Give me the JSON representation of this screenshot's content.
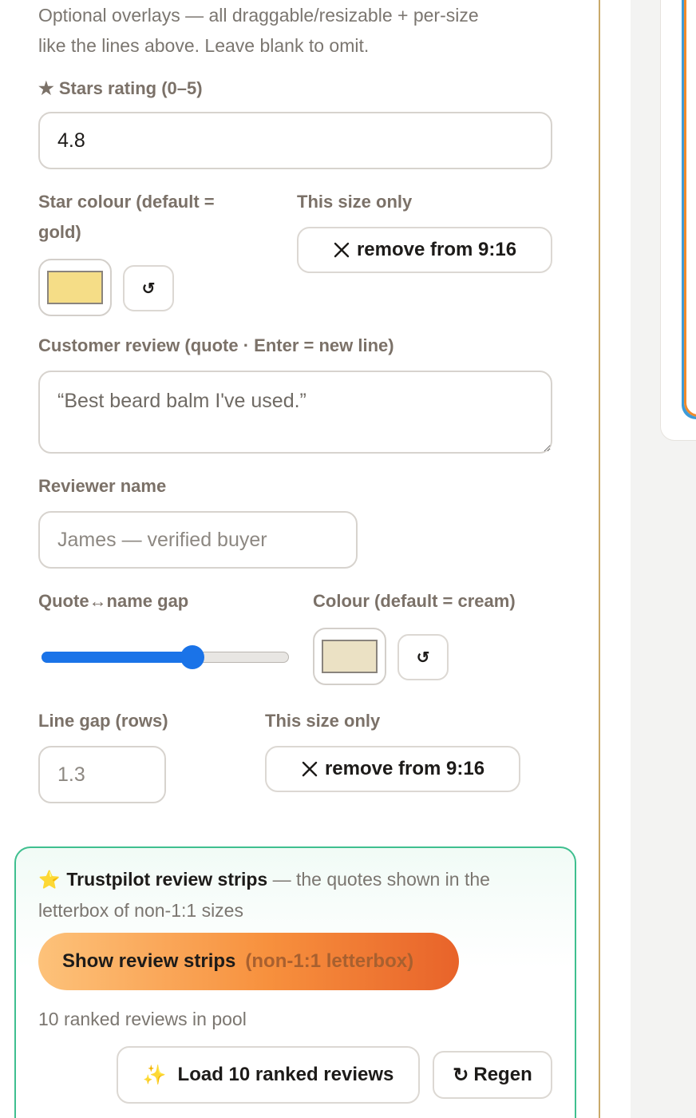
{
  "intro": {
    "help_line1": "Optional overlays — all draggable/resizable + per-size",
    "help_line2": "like the lines above. Leave blank to omit."
  },
  "stars": {
    "label": "★ Stars rating (0–5)",
    "value": "4.8",
    "colour_label_line1": "Star colour (default =",
    "colour_label_line2": "gold)",
    "colour_hex": "#f5dd87",
    "reset_label": "↺",
    "size_only_label": "This size only",
    "remove_label": "remove from 9:16"
  },
  "review": {
    "label": "Customer review (quote · Enter = new line)",
    "placeholder": "“Best beard balm I've used.”"
  },
  "reviewer": {
    "label": "Reviewer name",
    "placeholder": "James — verified buyer"
  },
  "gap": {
    "label": "Quote↔name gap",
    "slider_fraction": 0.61,
    "colour_label": "Colour (default = cream)",
    "colour_hex": "#ebe1c4",
    "reset_label": "↺"
  },
  "line_gap": {
    "label": "Line gap (rows)",
    "value": "1.3",
    "size_only_label": "This size only",
    "remove_label": "remove from 9:16"
  },
  "trustpilot": {
    "star_icon": "⭐",
    "title": "Trustpilot review strips",
    "desc_a": " — the quotes shown in the",
    "desc_b": "letterbox of non-1:1 sizes",
    "toggle_label": "Show review strips",
    "toggle_sub": "(non-1:1 letterbox)",
    "pool_text": "10 ranked reviews in pool",
    "load_icon": "✨",
    "load_label": "Load 10 ranked reviews",
    "regen_icon": "↻",
    "regen_label": "Regen"
  },
  "colors": {
    "accent_blue": "#1a73e8",
    "panel_border": "#3fbf8f",
    "divider_gold": "#c9a96a"
  }
}
